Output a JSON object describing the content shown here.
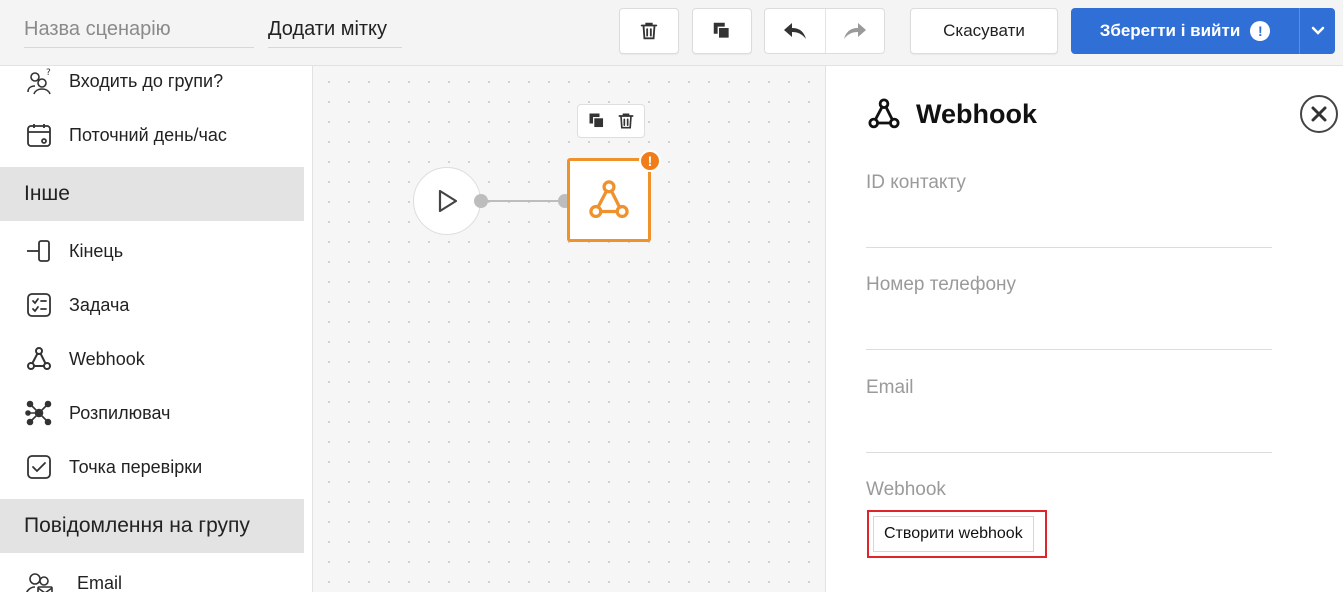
{
  "topbar": {
    "scenario_name_placeholder": "Назва сценарію",
    "add_tag_label": "Додати мітку",
    "cancel_label": "Скасувати",
    "save_label": "Зберегти і вийти",
    "save_alert": "!"
  },
  "palette": {
    "items_top": [
      {
        "label": "Входить до групи?",
        "icon": "group-question-icon"
      },
      {
        "label": "Поточний день/час",
        "icon": "calendar-clock-icon"
      }
    ],
    "section_other": "Інше",
    "items_other": [
      {
        "label": "Кінець",
        "icon": "end-icon"
      },
      {
        "label": "Задача",
        "icon": "task-checklist-icon"
      },
      {
        "label": "Webhook",
        "icon": "webhook-icon"
      },
      {
        "label": "Розпилювач",
        "icon": "splitter-icon"
      },
      {
        "label": "Точка перевірки",
        "icon": "checkpoint-icon"
      }
    ],
    "section_group": "Повідомлення на групу",
    "items_group": [
      {
        "label": "Email",
        "icon": "group-email-icon"
      }
    ]
  },
  "canvas": {
    "node_warning": "!"
  },
  "panel": {
    "title": "Webhook",
    "fields": [
      {
        "label": "ID контакту",
        "value": ""
      },
      {
        "label": "Номер телефону",
        "value": ""
      },
      {
        "label": "Email",
        "value": ""
      }
    ],
    "webhook_label": "Webhook",
    "create_button": "Створити webhook"
  },
  "colors": {
    "primary": "#2f6fd6",
    "node_accent": "#f0922c",
    "warning": "#f07d1a",
    "highlight": "#e0242b"
  }
}
